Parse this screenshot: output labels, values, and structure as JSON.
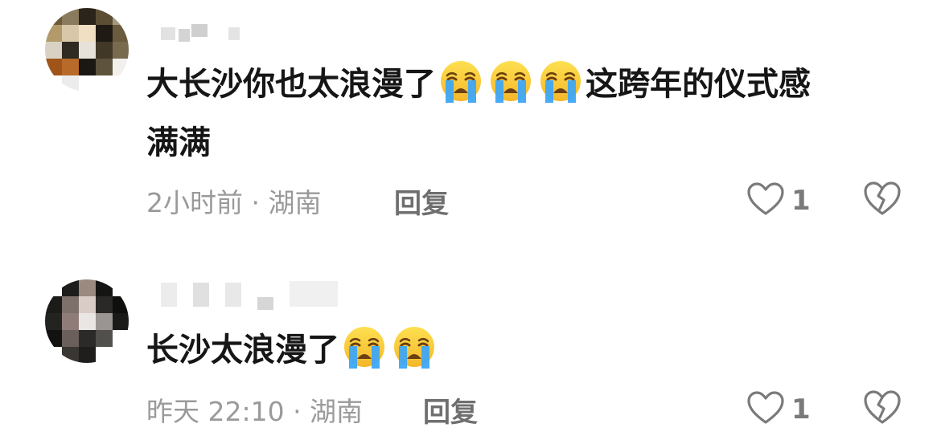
{
  "comments": [
    {
      "text_line1": "大长沙你也太浪漫了",
      "text_line1_after": "这跨年的仪式感",
      "text_line2": "满满",
      "emoji_count": 3,
      "emoji_icon": "loudly-crying-face-emoji",
      "meta": "2小时前 · 湖南",
      "reply_label": "回复",
      "like_count": "1"
    },
    {
      "text_line1": "长沙太浪漫了",
      "emoji_count": 2,
      "emoji_icon": "loudly-crying-face-emoji",
      "meta": "昨天 22:10 · 湖南",
      "reply_label": "回复",
      "like_count": "1"
    }
  ],
  "icons": {
    "like": "heart-outline-icon",
    "dislike": "broken-heart-icon"
  },
  "colors": {
    "text": "#161616",
    "meta": "#9a9a9a",
    "emoji_face": "#f7c631",
    "emoji_tear": "#3ea6f5"
  }
}
